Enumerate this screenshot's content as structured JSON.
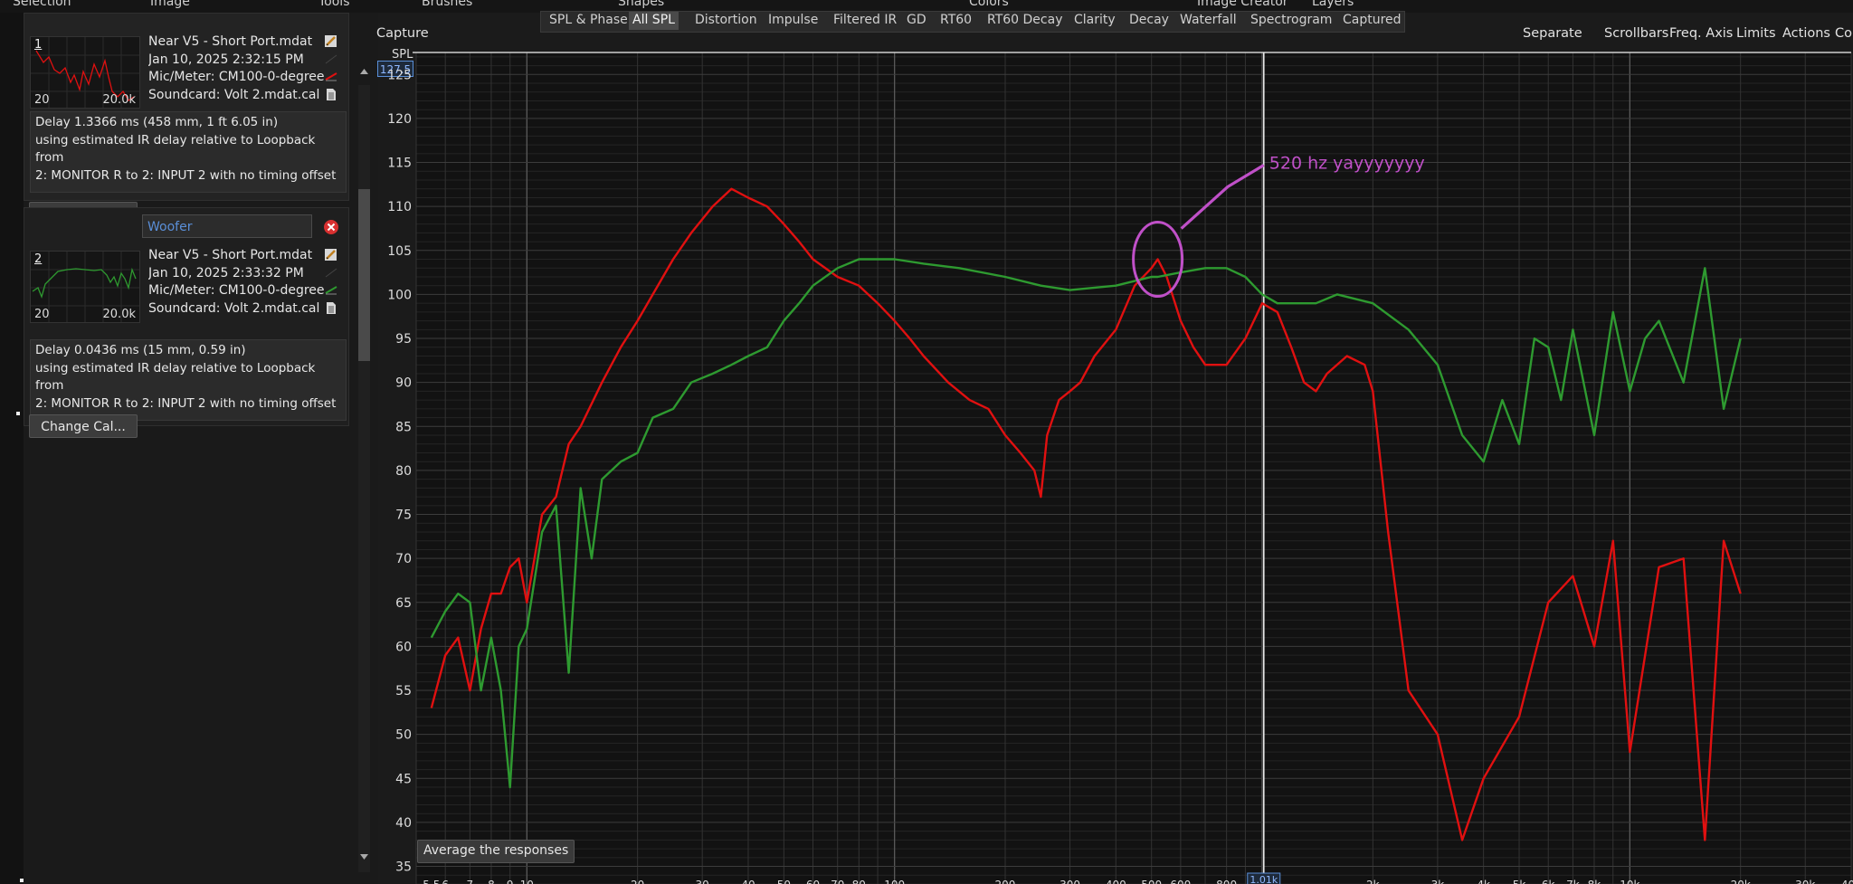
{
  "menu": [
    "Selection",
    "Image",
    "Tools",
    "Brushes",
    "Shapes",
    "Colors",
    "Image Creator",
    "Layers"
  ],
  "measurements": [
    {
      "index": "1",
      "name": "",
      "file": "Near V5 - Short Port.mdat",
      "date": "Jan 10, 2025 2:32:15 PM",
      "mic": "Mic/Meter: CM100-0-degree",
      "soundcard": "Soundcard: Volt 2.mdat.cal",
      "thumb_lo": "20",
      "thumb_hi": "20.0k",
      "color": "#e01010",
      "delay_lines": [
        "Delay 1.3366 ms (458 mm, 1 ft 6.05 in)",
        "using estimated IR delay relative to Loopback from",
        "2: MONITOR R to 2: INPUT 2 with no timing offset"
      ],
      "change_cal": "Change Cal..."
    },
    {
      "index": "2",
      "name": "Woofer",
      "file": "Near V5 - Short Port.mdat",
      "date": "Jan 10, 2025 2:33:32 PM",
      "mic": "Mic/Meter: CM100-0-degree",
      "soundcard": "Soundcard: Volt 2.mdat.cal",
      "thumb_lo": "20",
      "thumb_hi": "20.0k",
      "color": "#2e9a30",
      "delay_lines": [
        "Delay 0.0436 ms (15 mm, 0.59 in)",
        "using estimated IR delay relative to Loopback from",
        "2: MONITOR R to 2: INPUT 2 with no timing offset"
      ],
      "change_cal": "Change Cal..."
    }
  ],
  "tabs": [
    "SPL & Phase",
    "All SPL",
    "Distortion",
    "Impulse",
    "Filtered IR",
    "GD",
    "RT60",
    "RT60 Decay",
    "Clarity",
    "Decay",
    "Waterfall",
    "Spectrogram",
    "Captured"
  ],
  "active_tab": "All SPL",
  "toolbar": {
    "capture": "Capture",
    "separate": "Separate",
    "scrollbars": "Scrollbars",
    "freq_axis": "Freq. Axis",
    "limits": "Limits",
    "actions": "Actions",
    "controls": "Co"
  },
  "y_axis_label": "SPL",
  "y_top_value": "127.5",
  "cursor_freq": "1.01k",
  "average_button": "Average the responses",
  "annotation": "520 hz yayyyyyyy",
  "chart_data": {
    "type": "line",
    "title": "",
    "xlabel": "",
    "ylabel": "SPL",
    "xscale": "log",
    "xlim": [
      5,
      40000
    ],
    "ylim": [
      33,
      127.5
    ],
    "yticks": [
      35,
      40,
      45,
      50,
      55,
      60,
      65,
      70,
      75,
      80,
      85,
      90,
      95,
      100,
      105,
      110,
      115,
      120,
      125
    ],
    "xtick_labels": [
      {
        "f": 5.5,
        "t": "5.5"
      },
      {
        "f": 6,
        "t": "6"
      },
      {
        "f": 7,
        "t": "7"
      },
      {
        "f": 8,
        "t": "8"
      },
      {
        "f": 9,
        "t": "9"
      },
      {
        "f": 10,
        "t": "10"
      },
      {
        "f": 20,
        "t": "20"
      },
      {
        "f": 30,
        "t": "30"
      },
      {
        "f": 40,
        "t": "40"
      },
      {
        "f": 50,
        "t": "50"
      },
      {
        "f": 60,
        "t": "60"
      },
      {
        "f": 70,
        "t": "70"
      },
      {
        "f": 80,
        "t": "80"
      },
      {
        "f": 100,
        "t": "100"
      },
      {
        "f": 200,
        "t": "200"
      },
      {
        "f": 300,
        "t": "300"
      },
      {
        "f": 400,
        "t": "400"
      },
      {
        "f": 500,
        "t": "500"
      },
      {
        "f": 600,
        "t": "600"
      },
      {
        "f": 800,
        "t": "800"
      },
      {
        "f": 1000,
        "t": "1k"
      },
      {
        "f": 2000,
        "t": "2k"
      },
      {
        "f": 3000,
        "t": "3k"
      },
      {
        "f": 4000,
        "t": "4k"
      },
      {
        "f": 5000,
        "t": "5k"
      },
      {
        "f": 6000,
        "t": "6k"
      },
      {
        "f": 7000,
        "t": "7k"
      },
      {
        "f": 8000,
        "t": "8k"
      },
      {
        "f": 10000,
        "t": "10k"
      },
      {
        "f": 20000,
        "t": "20k"
      },
      {
        "f": 30000,
        "t": "30k"
      },
      {
        "f": 40000,
        "t": "40k"
      }
    ],
    "series": [
      {
        "name": "",
        "color": "#e01010",
        "x": [
          5.5,
          6,
          6.5,
          7,
          7.5,
          8,
          8.5,
          9,
          9.5,
          10,
          11,
          12,
          13,
          14,
          16,
          18,
          20,
          22,
          25,
          28,
          32,
          36,
          40,
          45,
          50,
          55,
          60,
          70,
          80,
          90,
          100,
          110,
          120,
          140,
          160,
          180,
          200,
          220,
          240,
          250,
          260,
          280,
          300,
          320,
          350,
          400,
          450,
          500,
          520,
          550,
          600,
          650,
          700,
          800,
          900,
          1000,
          1100,
          1200,
          1300,
          1400,
          1500,
          1700,
          1900,
          2000,
          2200,
          2500,
          3000,
          3500,
          4000,
          5000,
          6000,
          7000,
          8000,
          9000,
          10000,
          12000,
          14000,
          16000,
          18000,
          20000
        ],
        "y": [
          53,
          59,
          61,
          55,
          62,
          66,
          66,
          69,
          70,
          65,
          75,
          77,
          83,
          85,
          90,
          94,
          97,
          100,
          104,
          107,
          110,
          112,
          111,
          110,
          108,
          106,
          104,
          102,
          101,
          99,
          97,
          95,
          93,
          90,
          88,
          87,
          84,
          82,
          80,
          77,
          84,
          88,
          89,
          90,
          93,
          96,
          101,
          103,
          104,
          102,
          97,
          94,
          92,
          92,
          95,
          99,
          98,
          94,
          90,
          89,
          91,
          93,
          92,
          89,
          73,
          55,
          50,
          38,
          45,
          52,
          65,
          68,
          60,
          72,
          48,
          69,
          70,
          38,
          72,
          66
        ]
      },
      {
        "name": "Woofer",
        "color": "#2e9a30",
        "x": [
          5.5,
          6,
          6.5,
          7,
          7.5,
          8,
          8.5,
          9,
          9.5,
          10,
          11,
          12,
          13,
          14,
          15,
          16,
          18,
          20,
          22,
          25,
          28,
          32,
          36,
          40,
          45,
          50,
          55,
          60,
          70,
          80,
          90,
          100,
          120,
          150,
          200,
          250,
          300,
          400,
          500,
          520,
          600,
          700,
          800,
          900,
          1000,
          1100,
          1200,
          1400,
          1600,
          2000,
          2500,
          3000,
          3500,
          4000,
          4500,
          5000,
          5500,
          6000,
          6500,
          7000,
          8000,
          9000,
          10000,
          11000,
          12000,
          14000,
          16000,
          18000,
          20000
        ],
        "y": [
          61,
          64,
          66,
          65,
          55,
          61,
          55,
          44,
          60,
          62,
          73,
          76,
          57,
          78,
          70,
          79,
          81,
          82,
          86,
          87,
          90,
          91,
          92,
          93,
          94,
          97,
          99,
          101,
          103,
          104,
          104,
          104,
          103.5,
          103,
          102,
          101,
          100.5,
          101,
          102,
          102,
          102.5,
          103,
          103,
          102,
          100,
          99,
          99,
          99,
          100,
          99,
          96,
          92,
          84,
          81,
          88,
          83,
          95,
          94,
          88,
          96,
          84,
          98,
          89,
          95,
          97,
          90,
          103,
          87,
          95
        ]
      }
    ],
    "annotation": {
      "text": "520 hz yayyyyyyy",
      "freq": 520,
      "spl": 104
    }
  }
}
